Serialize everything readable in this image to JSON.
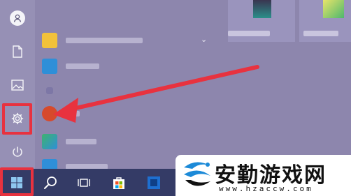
{
  "start_menu": {
    "rail": {
      "items": [
        "user",
        "documents",
        "pictures",
        "settings",
        "power"
      ]
    },
    "apps": [
      {
        "letter": "",
        "label": "",
        "icon_color": "#f2c23a"
      },
      {
        "letter": "",
        "label": "",
        "icon_color": "#2f8fd8"
      },
      {
        "letter": "",
        "label": "",
        "icon_color": "#2f8fd8"
      },
      {
        "letter": "",
        "label": "",
        "icon_color": "#d64a2c"
      },
      {
        "letter": "",
        "label": "",
        "icon_color": "#3fb36f"
      },
      {
        "letter": "",
        "label": "",
        "icon_color": "#2f8fd8"
      }
    ],
    "group_chevron": "⌄"
  },
  "taskbar": {
    "items": [
      "start",
      "search",
      "task-view",
      "store",
      "app"
    ]
  },
  "watermark": {
    "title": "安勤游戏网",
    "url": "www.hzaccw.com"
  },
  "colors": {
    "highlight": "#e8323f",
    "taskbar": "#343b66",
    "menu_bg": "#8d86ad"
  }
}
